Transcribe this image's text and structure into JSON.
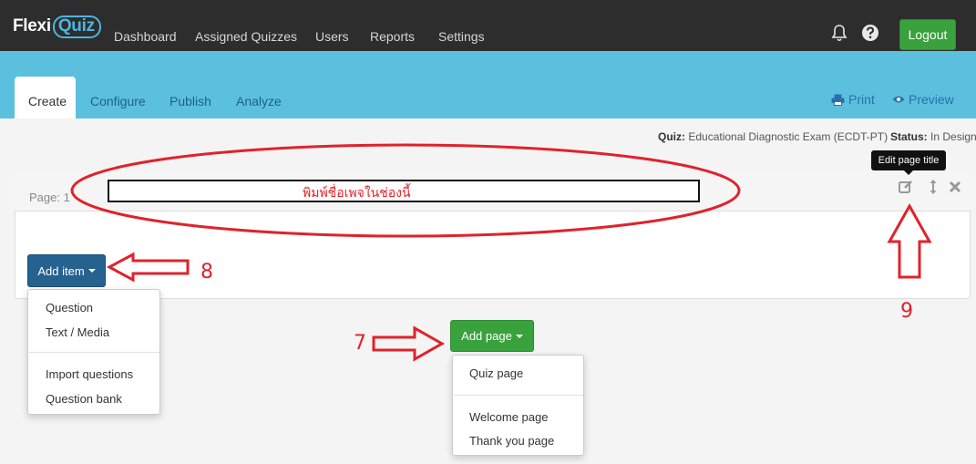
{
  "app": {
    "logo_prefix": "Flexi",
    "logo_suffix": "Quiz"
  },
  "topnav": {
    "items": [
      "Dashboard",
      "Assigned Quizzes",
      "Users",
      "Reports",
      "Settings"
    ],
    "logout_label": "Logout"
  },
  "tabs": {
    "active": "Create",
    "items": [
      "Configure",
      "Publish",
      "Analyze"
    ],
    "print_label": "Print",
    "preview_label": "Preview"
  },
  "quiz_info": {
    "quiz_key": "Quiz:",
    "quiz_value": "Educational Diagnostic Exam (ECDT-PT)",
    "status_key": "Status:",
    "status_value": "In Design"
  },
  "tooltip": "Edit page title",
  "page_panel": {
    "page_label": "Page: 1",
    "title_value": "พิมพ์ชื่อเพจในช่องนี้"
  },
  "add_item": {
    "label": "Add item",
    "menu": [
      "Question",
      "Text / Media",
      "Import questions",
      "Question bank"
    ]
  },
  "add_page": {
    "label": "Add page",
    "menu": [
      "Quiz page",
      "Welcome page",
      "Thank you page"
    ]
  },
  "annotations": {
    "num_7": "7",
    "num_8": "8",
    "num_9": "9",
    "color": "#e0222b"
  },
  "colors": {
    "nav_bg": "#2d2d2d",
    "band": "#5bc0de",
    "green": "#3aa23d",
    "blue_btn": "#25628f",
    "link": "#2a6fb0"
  }
}
